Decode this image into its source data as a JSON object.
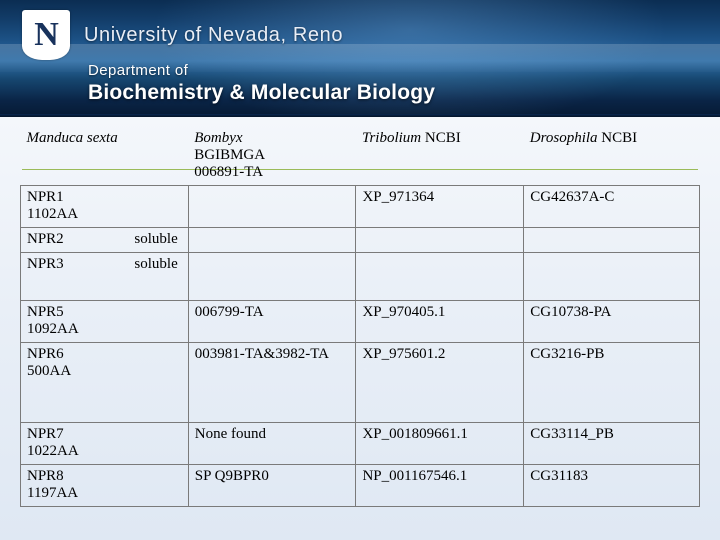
{
  "header": {
    "logo_letter": "N",
    "university": "University of Nevada, Reno",
    "dept_line1": "Department of",
    "dept_line2": "Biochemistry & Molecular Biology"
  },
  "table": {
    "headers": [
      {
        "italic": "Manduca sexta",
        "rest": ""
      },
      {
        "italic": "Bombyx",
        "rest": " BGIBMGA 006891-TA"
      },
      {
        "italic": "Tribolium",
        "rest": " NCBI"
      },
      {
        "italic": "Drosophila",
        "rest": " NCBI"
      }
    ],
    "header_plain": {
      "c1_italic": "Manduca sexta",
      "c1_rest": "",
      "c2_italic": "Bombyx",
      "c2_rest": "BGIBMGA",
      "c2_rest2": "006891-TA",
      "c3_italic": "Tribolium",
      "c3_rest": " NCBI",
      "c4_italic": "Drosophila",
      "c4_rest": " NCBI"
    },
    "rows": [
      {
        "name": "NPR1",
        "size": "",
        "detail": "1102AA",
        "bombyx": "",
        "tribolium": "XP_971364",
        "drosophila": "CG42637A-C"
      },
      {
        "name": "NPR2",
        "size": "soluble",
        "detail": "",
        "bombyx": "",
        "tribolium": "",
        "drosophila": ""
      },
      {
        "name": "NPR3",
        "size": "soluble",
        "detail": "",
        "bombyx": "",
        "tribolium": "",
        "drosophila": ""
      },
      {
        "name": "NPR5",
        "size": "",
        "detail": "1092AA",
        "bombyx": "006799-TA",
        "tribolium": "XP_970405.1",
        "drosophila": "CG10738-PA"
      },
      {
        "name": "NPR6",
        "size": "",
        "detail": "500AA",
        "bombyx": "003981-TA&3982-TA",
        "tribolium": "XP_975601.2",
        "drosophila": "CG3216-PB"
      },
      {
        "name": "NPR7",
        "size": "",
        "detail": "1022AA",
        "bombyx": "None found",
        "tribolium": "XP_001809661.1",
        "drosophila": "CG33114_PB"
      },
      {
        "name": "NPR8",
        "size": "",
        "detail": "1197AA",
        "bombyx": "SP Q9BPR0",
        "tribolium": "NP_001167546.1",
        "drosophila": "CG31183"
      }
    ]
  },
  "colors": {
    "banner_dark": "#0b2d52",
    "banner_light": "#2f6ea6",
    "accent_rule": "#9bbb59",
    "text": "#000000"
  }
}
